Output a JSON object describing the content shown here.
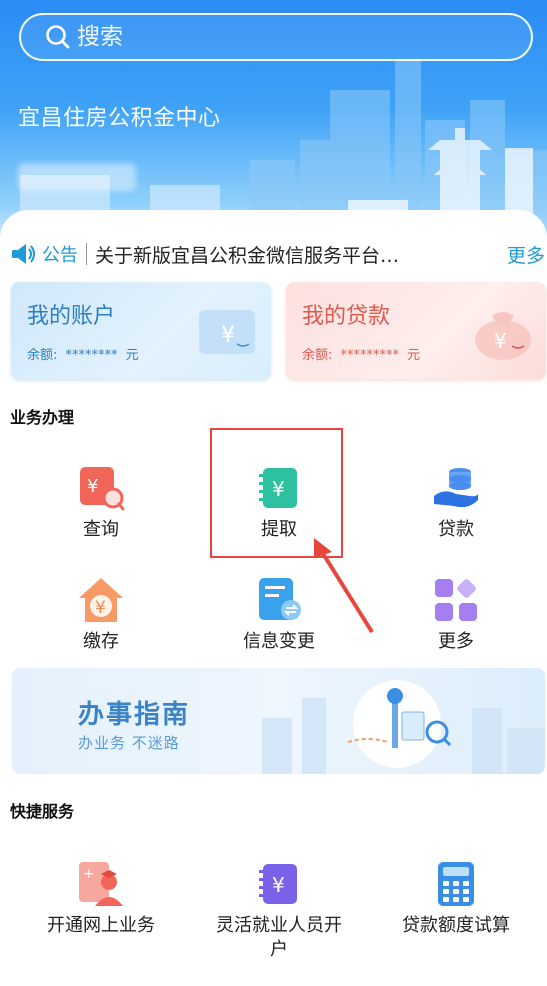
{
  "search": {
    "placeholder": "搜索"
  },
  "header": {
    "title": "宜昌住房公积金中心"
  },
  "notice": {
    "tag": "公告",
    "text": "关于新版宜昌公积金微信服务平台…",
    "more": "更多"
  },
  "cards": {
    "account": {
      "title": "我的账户",
      "balance_label": "余额:",
      "balance_value": "********",
      "unit": "元"
    },
    "loan": {
      "title": "我的贷款",
      "balance_label": "余额:",
      "balance_value": "*********",
      "unit": "元"
    }
  },
  "business": {
    "title": "业务办理",
    "items": [
      {
        "label": "查询",
        "icon": "query-icon"
      },
      {
        "label": "提取",
        "icon": "withdraw-icon"
      },
      {
        "label": "贷款",
        "icon": "loan-icon"
      },
      {
        "label": "缴存",
        "icon": "deposit-icon"
      },
      {
        "label": "信息变更",
        "icon": "info-change-icon"
      },
      {
        "label": "更多",
        "icon": "more-grid-icon"
      }
    ]
  },
  "guide": {
    "title": "办事指南",
    "subtitle": "办业务 不迷路"
  },
  "quick": {
    "title": "快捷服务",
    "items": [
      {
        "label": "开通网上业务",
        "icon": "online-business-icon"
      },
      {
        "label": "灵活就业人员开户",
        "icon": "flexible-employment-icon"
      },
      {
        "label": "贷款额度试算",
        "icon": "calculator-icon"
      }
    ]
  },
  "colors": {
    "accent": "#1e9bd7",
    "header_blue": "#2a8cf4",
    "loan_red": "#e0594f",
    "highlight_red": "#e8453c"
  }
}
